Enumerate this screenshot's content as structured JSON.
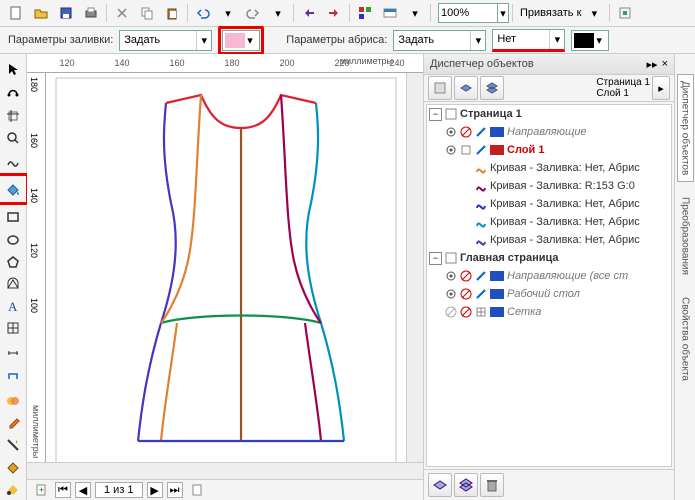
{
  "toolbar1": {
    "zoom": "100%",
    "snap_label": "Привязать к"
  },
  "toolbar2": {
    "fill_params": "Параметры заливки:",
    "fill_select": "Задать",
    "outline_params": "Параметры абриса:",
    "outline_select": "Задать",
    "outline_width": "Нет",
    "fill_swatch": "#f7b8d4",
    "outline_swatch": "#000000"
  },
  "ruler": {
    "unit": "миллиметры",
    "h_ticks": [
      "120",
      "140",
      "160",
      "180",
      "200",
      "220",
      "240"
    ],
    "v_ticks": [
      "180",
      "160",
      "140",
      "120",
      "100"
    ]
  },
  "status": {
    "page_info": "1 из 1"
  },
  "docker": {
    "title": "Диспетчер объектов",
    "header1": "Страница 1",
    "header2": "Слой 1",
    "page1": "Страница 1",
    "layer1": "Слой 1",
    "guides": "Направляющие",
    "curves": [
      "Кривая - Заливка: Нет, Абрис",
      "Кривая - Заливка: R:153 G:0",
      "Кривая - Заливка: Нет, Абрис",
      "Кривая - Заливка: Нет, Абрис",
      "Кривая - Заливка: Нет, Абрис"
    ],
    "master": "Главная страница",
    "master_guides": "Направляющие (все ст",
    "desktop": "Рабочий стол",
    "grid": "Сетка"
  },
  "side_tabs": [
    "Диспетчер объектов",
    "Преобразования",
    "Свойства объекта"
  ],
  "curve_colors": [
    "#e08030",
    "#900050",
    "#2030c0",
    "#0090c0",
    "#5030c0"
  ]
}
